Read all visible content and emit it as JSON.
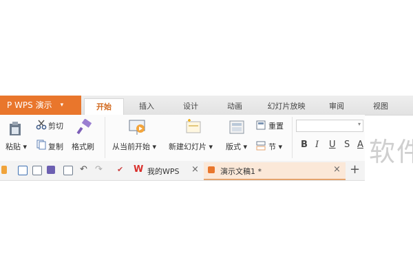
{
  "app_menu": {
    "label": "P WPS 演示",
    "caret": "▾"
  },
  "tabs": [
    {
      "label": "开始",
      "active": true
    },
    {
      "label": "插入"
    },
    {
      "label": "设计"
    },
    {
      "label": "动画"
    },
    {
      "label": "幻灯片放映"
    },
    {
      "label": "审阅"
    },
    {
      "label": "视图"
    }
  ],
  "ribbon": {
    "cut": "剪切",
    "paste": "粘贴 ▾",
    "copy": "复制",
    "format_painter": "格式刷",
    "start_from_current": "从当前开始 ▾",
    "new_slide": "新建幻灯片 ▾",
    "layout": "版式 ▾",
    "reset": "重置",
    "section": "节 ▾",
    "font_bold": "B",
    "font_italic": "I",
    "font_underline": "U",
    "font_strike": "S",
    "font_color": "A"
  },
  "doc_tabs": {
    "my_wps": "我的WPS",
    "presentation": "演示文稿1 *",
    "close": "×",
    "add": "+"
  },
  "watermark": "软件",
  "colors": {
    "accent": "#e9762c",
    "active_tab_text": "#d2691e",
    "doc_tab_active_bg": "#fbe8d8"
  }
}
